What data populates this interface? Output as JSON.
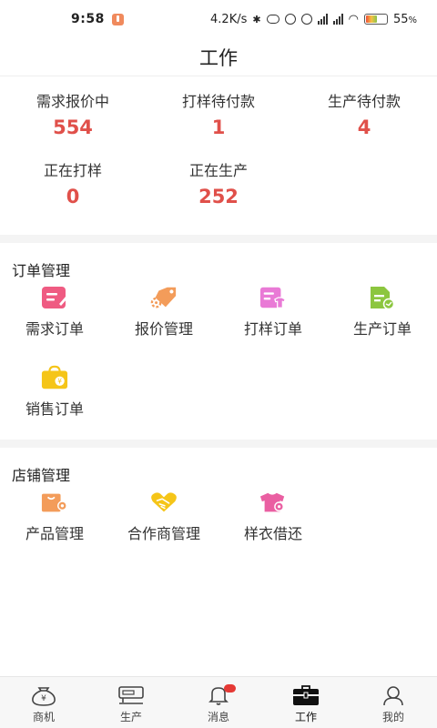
{
  "status_bar": {
    "time": "9:58",
    "network_speed": "4.2K/s",
    "battery_percent": "55",
    "battery_unit": "%"
  },
  "header": {
    "title": "工作"
  },
  "stats": [
    {
      "label": "需求报价中",
      "value": "554"
    },
    {
      "label": "打样待付款",
      "value": "1"
    },
    {
      "label": "生产待付款",
      "value": "4"
    },
    {
      "label": "正在打样",
      "value": "0"
    },
    {
      "label": "正在生产",
      "value": "252"
    }
  ],
  "order_section": {
    "title": "订单管理",
    "items": [
      {
        "label": "需求订单",
        "icon": "demand-order-icon"
      },
      {
        "label": "报价管理",
        "icon": "quote-tag-icon"
      },
      {
        "label": "打样订单",
        "icon": "sample-order-icon"
      },
      {
        "label": "生产订单",
        "icon": "production-order-icon"
      },
      {
        "label": "销售订单",
        "icon": "sales-bag-icon"
      }
    ]
  },
  "store_section": {
    "title": "店铺管理",
    "items": [
      {
        "label": "产品管理",
        "icon": "product-box-icon"
      },
      {
        "label": "合作商管理",
        "icon": "handshake-icon"
      },
      {
        "label": "样衣借还",
        "icon": "shirt-icon"
      }
    ]
  },
  "tabbar": {
    "items": [
      {
        "label": "商机",
        "icon": "money-bag-icon"
      },
      {
        "label": "生产",
        "icon": "sewing-machine-icon"
      },
      {
        "label": "消息",
        "icon": "bell-icon"
      },
      {
        "label": "工作",
        "icon": "toolbox-icon"
      },
      {
        "label": "我的",
        "icon": "person-icon"
      }
    ],
    "active": "工作"
  },
  "colors": {
    "stat_value": "#e0504a",
    "demand_icon": "#ef5b82",
    "quote_icon": "#f39c5a",
    "sample_icon": "#e97ad6",
    "production_icon": "#8cc63f",
    "sales_icon": "#f5c518",
    "handshake_icon": "#f5c518",
    "shirt_icon": "#ea5fa2",
    "message_badge": "#e53935"
  }
}
